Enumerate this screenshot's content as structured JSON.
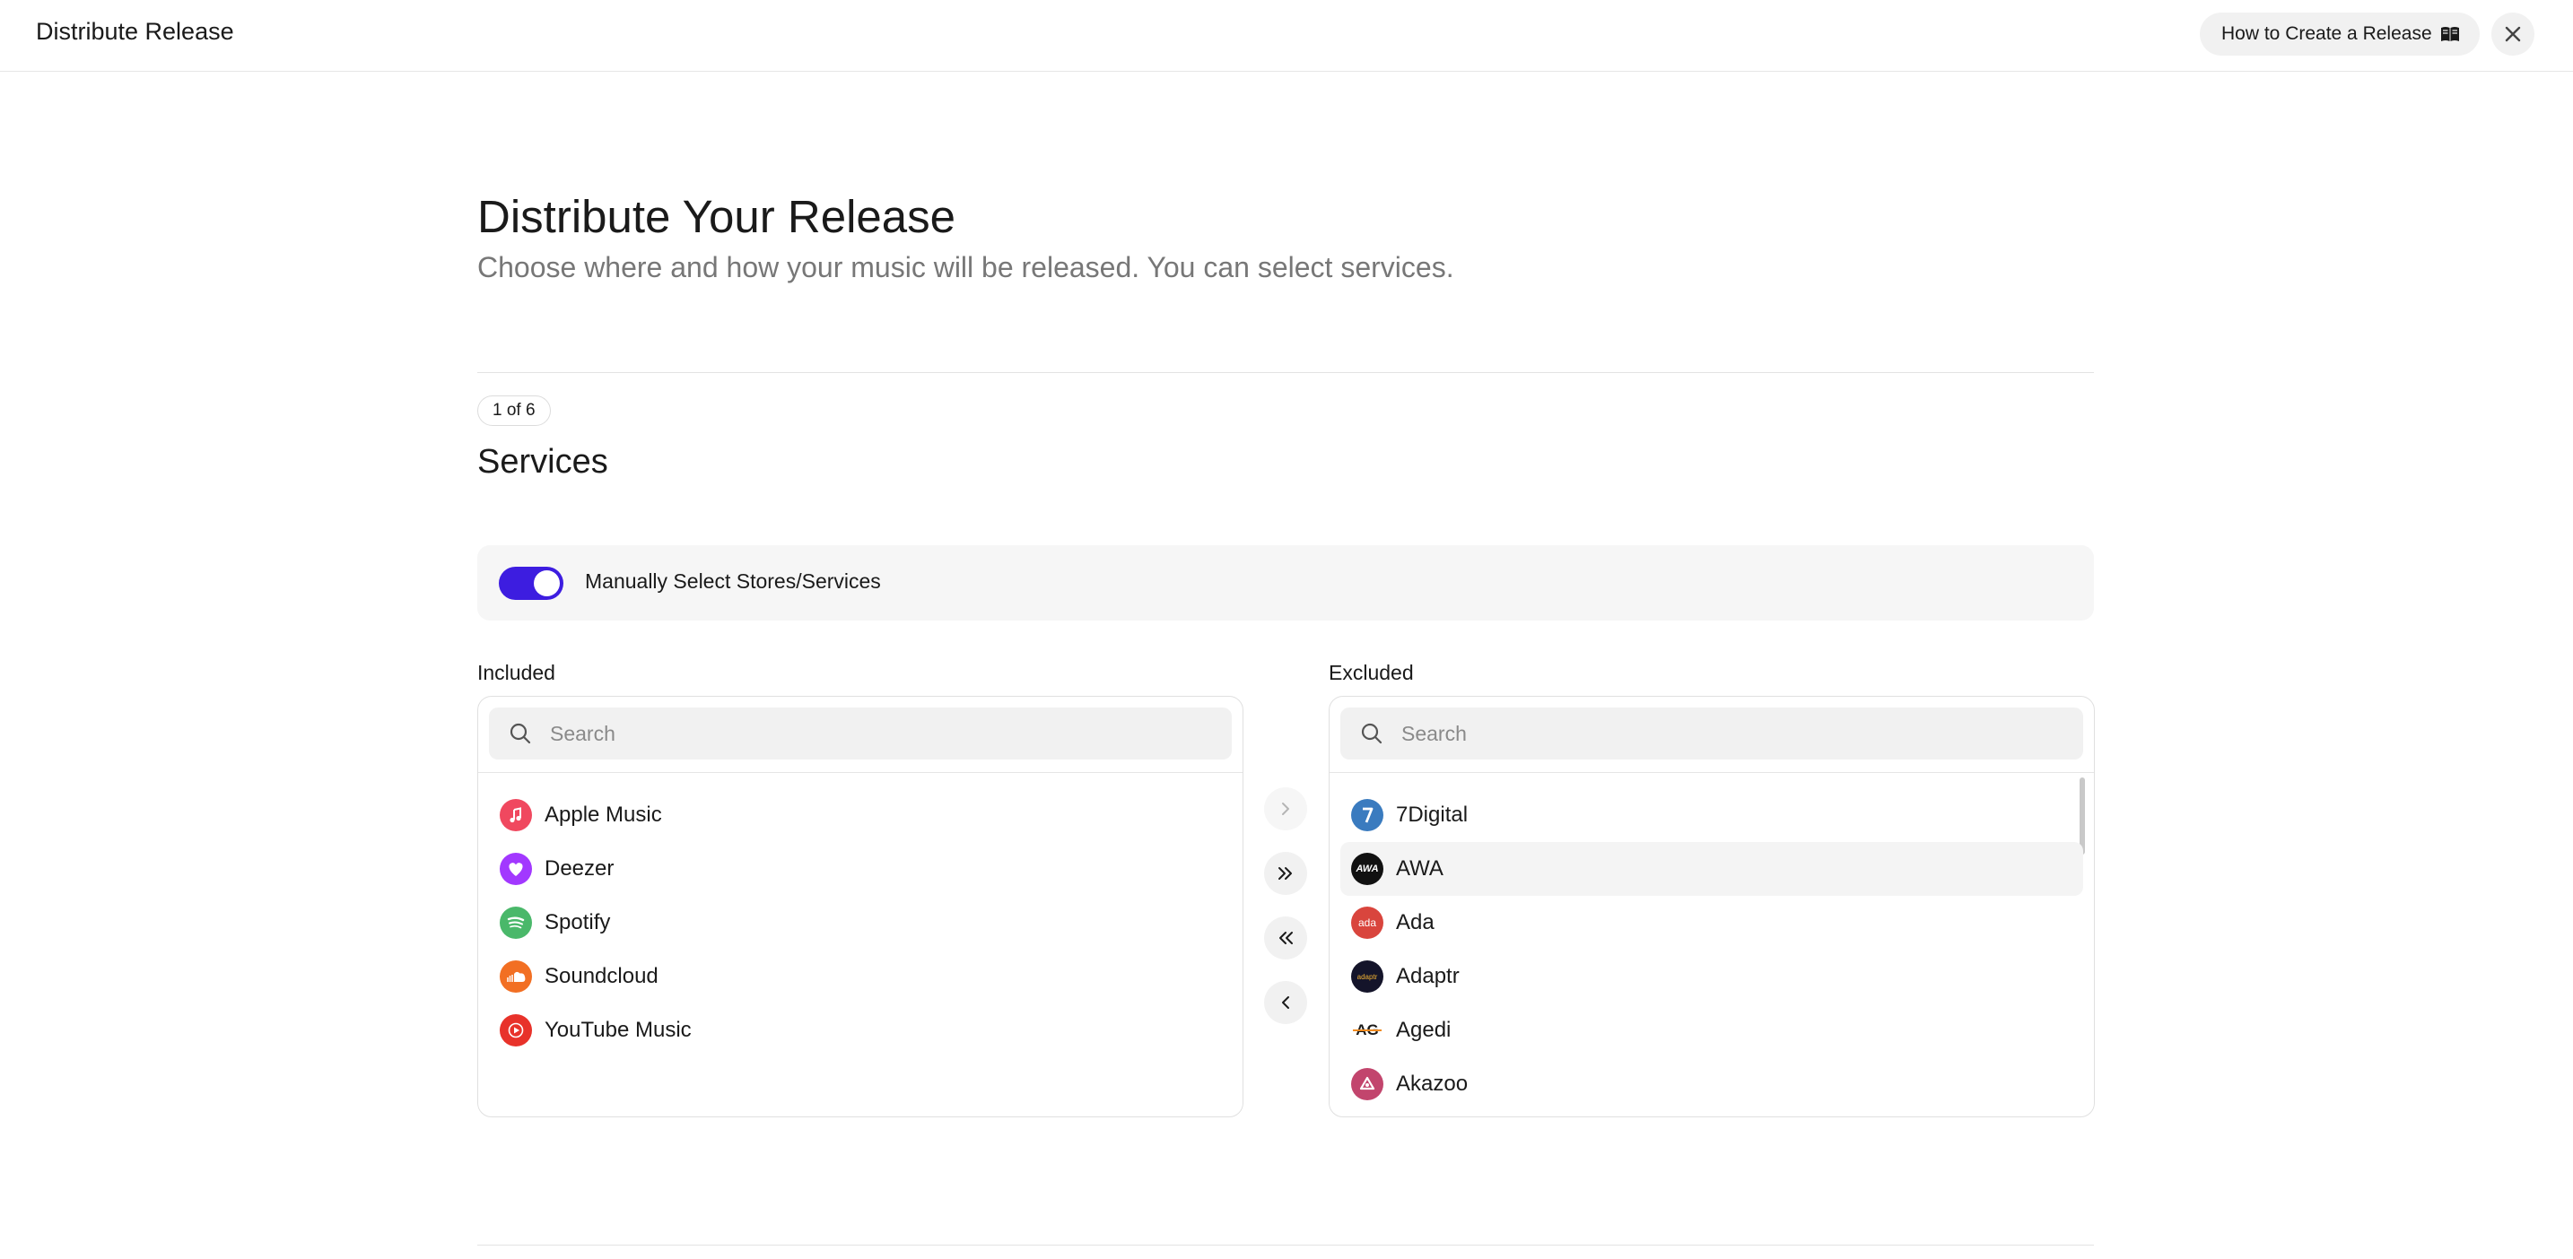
{
  "topbar": {
    "title": "Distribute Release",
    "help_label": "How to Create a Release",
    "help_icon": "book-icon",
    "close_icon": "close-icon"
  },
  "header": {
    "title": "Distribute Your Release",
    "subtitle": "Choose where and how your music will be released. You can select services."
  },
  "step": {
    "badge": "1 of 6",
    "title": "Services"
  },
  "manual_select": {
    "label": "Manually Select Stores/Services",
    "enabled": true,
    "accent_color": "#3d1de0"
  },
  "included": {
    "label": "Included",
    "search_placeholder": "Search",
    "items": [
      {
        "name": "Apple Music",
        "icon": "apple-music-icon",
        "color": "#f0485f"
      },
      {
        "name": "Deezer",
        "icon": "deezer-heart-icon",
        "color": "#a238ff"
      },
      {
        "name": "Spotify",
        "icon": "spotify-icon",
        "color": "#4ab86a"
      },
      {
        "name": "Soundcloud",
        "icon": "soundcloud-icon",
        "color": "#f26f23"
      },
      {
        "name": "YouTube Music",
        "icon": "youtube-music-icon",
        "color": "#e8322a"
      }
    ]
  },
  "excluded": {
    "label": "Excluded",
    "search_placeholder": "Search",
    "items": [
      {
        "name": "7Digital",
        "icon": "7digital-icon",
        "color": "#3a7bbf"
      },
      {
        "name": "AWA",
        "icon": "awa-icon",
        "logo_text": "AWA",
        "color": "#111111"
      },
      {
        "name": "Ada",
        "icon": "ada-icon",
        "logo_text": "ada",
        "color": "#d9453d"
      },
      {
        "name": "Adaptr",
        "icon": "adaptr-icon",
        "logo_text": "adaptr",
        "color": "#14142a"
      },
      {
        "name": "Agedi",
        "icon": "agedi-icon",
        "logo_text": "AG",
        "color": "#f08a1f"
      },
      {
        "name": "Akazoo",
        "icon": "akazoo-icon",
        "color": "#c2456d"
      }
    ]
  },
  "transfer_buttons": [
    {
      "action": "move-selected-right",
      "icon": "chevron-right-icon"
    },
    {
      "action": "move-all-right",
      "icon": "double-chevron-right-icon"
    },
    {
      "action": "move-all-left",
      "icon": "double-chevron-left-icon"
    },
    {
      "action": "move-selected-left",
      "icon": "chevron-left-icon"
    }
  ]
}
